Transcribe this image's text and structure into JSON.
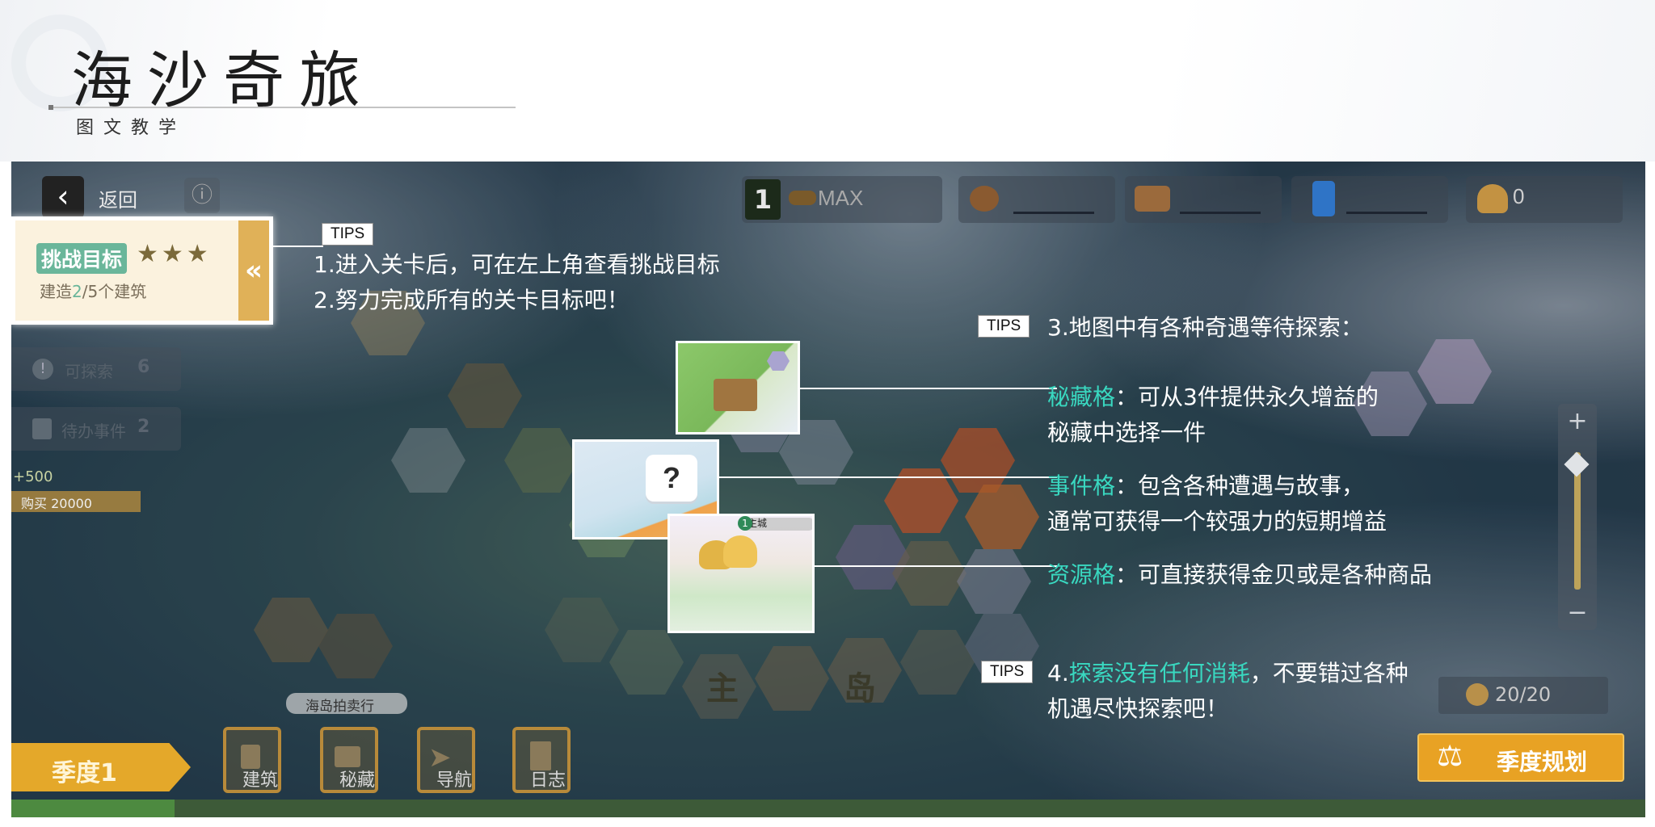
{
  "header": {
    "title": "海沙奇旅",
    "subtitle": "图文教学"
  },
  "game": {
    "back_label": "返回",
    "level_number": "1",
    "level_max": "MAX",
    "shell_count": "0",
    "goal": {
      "title": "挑战目标",
      "stars": "★★★",
      "desc_prefix": "建造",
      "desc_done": "2",
      "desc_suffix": "/5个建筑",
      "collapse_glyph": "«"
    },
    "side": {
      "explorable_label": "可探索",
      "explorable_count": "6",
      "events_label": "待办事件",
      "events_count": "2"
    },
    "map_labels": {
      "bay_label": "海岛拍卖行",
      "island_left": "主",
      "island_right": "岛",
      "hex_number": "1",
      "hex_tag": "主城",
      "shop_reward": "+500",
      "shop_price": "购买 20000"
    },
    "counter": "20/20",
    "season_plan": "季度规划",
    "season": "季度1",
    "bottom_buttons": [
      "建筑",
      "秘藏",
      "导航",
      "日志"
    ],
    "progress": 0.1
  },
  "tips": {
    "tag": "TIPS",
    "tip1_line1": "1.进入关卡后，可在左上角查看挑战目标",
    "tip1_line2": "2.努力完成所有的关卡目标吧！",
    "tip3_title": "3.地图中有各种奇遇等待探索：",
    "secret_name": "秘藏格",
    "secret_desc1": "：可从3件提供永久增益的",
    "secret_desc2": "秘藏中选择一件",
    "event_name": "事件格",
    "event_desc1": "：包含各种遭遇与故事，",
    "event_desc2": "通常可获得一个较强力的短期增益",
    "resource_name": "资源格",
    "resource_desc": "：可直接获得金贝或是各种商品",
    "tip4_prefix": "4.",
    "tip4_highlight": "探索没有任何消耗",
    "tip4_rest": "，不要错过各种",
    "tip4_line2": "机遇尽快探索吧！"
  },
  "colors": {
    "highlight": "#39d8c0",
    "gold": "#e4a82a",
    "goal_green": "#6ab69a"
  }
}
